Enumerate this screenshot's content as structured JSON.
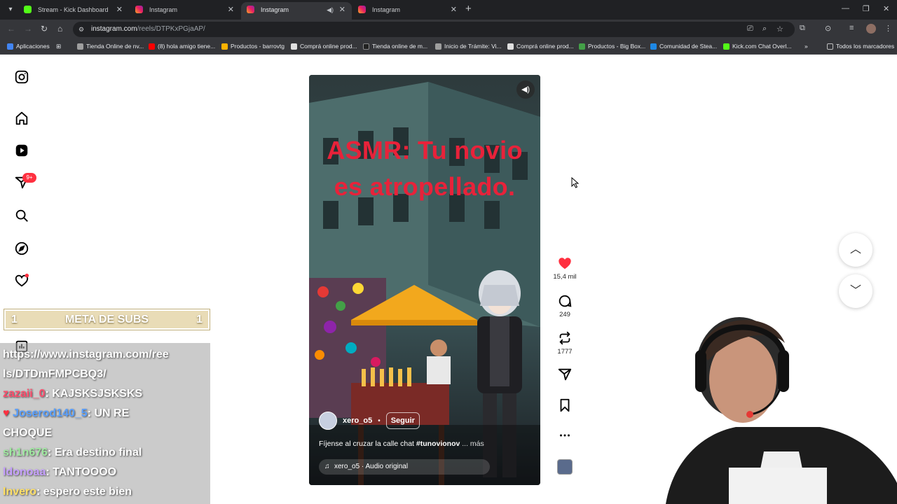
{
  "tabs": [
    {
      "title": "Stream - Kick Dashboard",
      "favicon": "kick-icon"
    },
    {
      "title": "Instagram",
      "favicon": "instagram-icon"
    },
    {
      "title": "Instagram",
      "favicon": "instagram-icon",
      "active": true,
      "muted_icon": "speaker-icon"
    },
    {
      "title": "Instagram",
      "favicon": "instagram-icon"
    }
  ],
  "address": {
    "host": "instagram.com",
    "path": "/reels/DTPKxPGjaAP/"
  },
  "bookmarks": [
    {
      "label": "Aplicaciones",
      "color": "#4285f4"
    },
    {
      "label": "Tienda Online de nv...",
      "color": "#9e9e9e"
    },
    {
      "label": "(8) hola amigo tiene...",
      "color": "#ff0000"
    },
    {
      "label": "Productos - barrovtg",
      "color": "#ffb300"
    },
    {
      "label": "Comprá online prod...",
      "color": "#e0e0e0"
    },
    {
      "label": "Tienda online de m...",
      "color": "#212121"
    },
    {
      "label": "Inicio de Trámite: Vi...",
      "color": "#9e9e9e"
    },
    {
      "label": "Comprá online prod...",
      "color": "#e0e0e0"
    },
    {
      "label": "Productos - Big Box...",
      "color": "#43a047"
    },
    {
      "label": "Comunidad de Stea...",
      "color": "#1e88e5"
    },
    {
      "label": "Kick.com Chat Overl...",
      "color": "#53fc18"
    },
    {
      "label": "Todos los marcadores",
      "color": "#bdbdbd"
    }
  ],
  "sidebar": {
    "notification_badge": "9+"
  },
  "reel": {
    "overlay_text_line1": "ASMR: Tu novio",
    "overlay_text_line2": "es atropellado.",
    "username": "xero_o5",
    "separator": "•",
    "follow_label": "Seguir",
    "caption": "Fíjense al cruzar la calle chat",
    "hashtag": "#tunovionov",
    "more_label": "... más",
    "audio": "xero_o5 · Audio original"
  },
  "actions": {
    "likes": "15,4 mil",
    "comments": "249",
    "reposts": "1777"
  },
  "stream_overlay": {
    "subs_left": "1",
    "subs_label": "META DE SUBS",
    "subs_right": "1",
    "chat": [
      {
        "user": "",
        "message": "https://www.instagram.com/ree",
        "color": "#ffffff"
      },
      {
        "user": "",
        "message": "ls/DTDmFMPCBQ3/",
        "color": "#ffffff"
      },
      {
        "user": "zazaii_0",
        "message": ": KAJSKSJSKSKS",
        "color": "#ff4d6d"
      },
      {
        "user": "Joserod140_5",
        "message": ": UN RE",
        "color": "#5aa0ff"
      },
      {
        "user": "",
        "message": "CHOQUE",
        "color": "#ffffff"
      },
      {
        "user": "sh1n676",
        "message": ": Era destino final",
        "color": "#9fe8a0"
      },
      {
        "user": "ldonoaa",
        "message": ": TANTOOOO",
        "color": "#c6a0ff"
      },
      {
        "user": "Invero",
        "message": ": espero este bien",
        "color": "#ffe066"
      }
    ]
  },
  "colors": {
    "like_red": "#ff3040",
    "overlay_title_red": "#e8223a",
    "chrome_dark": "#202124"
  }
}
